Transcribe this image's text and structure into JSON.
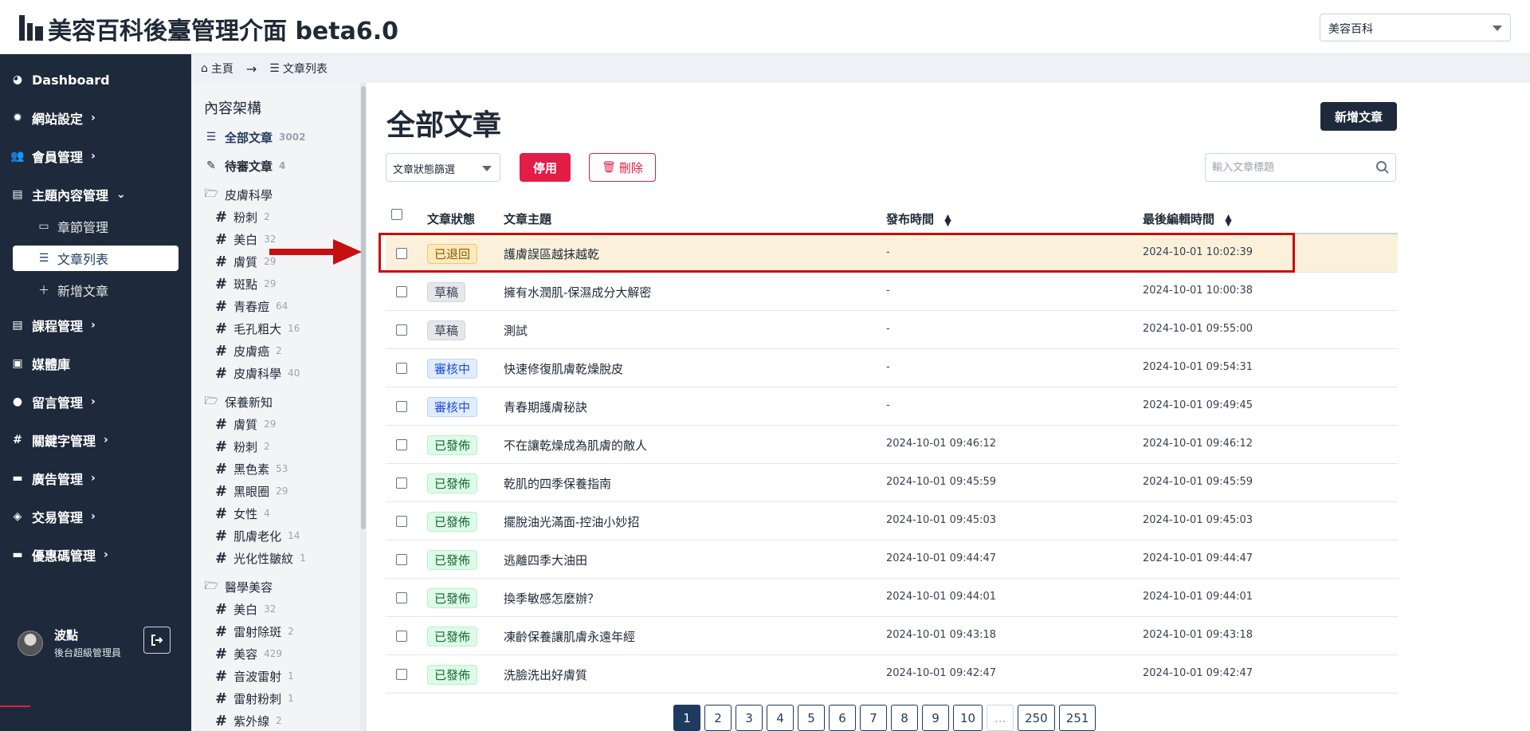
{
  "app": {
    "title": "美容百科後臺管理介面 beta6.0",
    "site_selector": "美容百科"
  },
  "sidebar": {
    "items": [
      {
        "label": "Dashboard",
        "icon": "dashboard-icon"
      },
      {
        "label": "網站設定",
        "icon": "gear-icon"
      },
      {
        "label": "會員管理",
        "icon": "users-icon"
      },
      {
        "label": "主題內容管理",
        "icon": "book-icon"
      },
      {
        "label": "課程管理",
        "icon": "book-icon"
      },
      {
        "label": "媒體庫",
        "icon": "images-icon"
      },
      {
        "label": "留言管理",
        "icon": "comment-icon"
      },
      {
        "label": "關鍵字管理",
        "icon": "hashtag-icon"
      },
      {
        "label": "廣告管理",
        "icon": "ad-icon"
      },
      {
        "label": "交易管理",
        "icon": "money-bag-icon"
      },
      {
        "label": "優惠碼管理",
        "icon": "ticket-icon"
      }
    ],
    "subitems": [
      {
        "label": "章節管理",
        "icon": "panel-icon"
      },
      {
        "label": "文章列表",
        "icon": "list-icon"
      },
      {
        "label": "新增文章",
        "icon": "plus-icon"
      }
    ],
    "user": {
      "name": "波點",
      "role": "後台超級管理員"
    }
  },
  "breadcrumb": {
    "home": "主頁",
    "current": "文章列表"
  },
  "tag_panel": {
    "title": "內容架構",
    "all": {
      "label": "全部文章",
      "count": "3002"
    },
    "pending": {
      "label": "待審文章",
      "count": "4"
    },
    "groups": [
      {
        "label": "皮膚科學",
        "tags": [
          {
            "label": "粉刺",
            "count": "2"
          },
          {
            "label": "美白",
            "count": "32"
          },
          {
            "label": "膚質",
            "count": "29"
          },
          {
            "label": "斑點",
            "count": "29"
          },
          {
            "label": "青春痘",
            "count": "64"
          },
          {
            "label": "毛孔粗大",
            "count": "16"
          },
          {
            "label": "皮膚癌",
            "count": "2"
          },
          {
            "label": "皮膚科學",
            "count": "40"
          }
        ]
      },
      {
        "label": "保養新知",
        "tags": [
          {
            "label": "膚質",
            "count": "29"
          },
          {
            "label": "粉刺",
            "count": "2"
          },
          {
            "label": "黑色素",
            "count": "53"
          },
          {
            "label": "黑眼圈",
            "count": "29"
          },
          {
            "label": "女性",
            "count": "4"
          },
          {
            "label": "肌膚老化",
            "count": "14"
          },
          {
            "label": "光化性皺紋",
            "count": "1"
          }
        ]
      },
      {
        "label": "醫學美容",
        "tags": [
          {
            "label": "美白",
            "count": "32"
          },
          {
            "label": "雷射除斑",
            "count": "2"
          },
          {
            "label": "美容",
            "count": "429"
          },
          {
            "label": "音波雷射",
            "count": "1"
          },
          {
            "label": "雷射粉刺",
            "count": "1"
          },
          {
            "label": "紫外線",
            "count": "2"
          }
        ]
      }
    ]
  },
  "main": {
    "title": "全部文章",
    "new_button": "新增文章",
    "filter": "文章狀態篩選",
    "disable_button": "停用",
    "delete_button": "刪除",
    "search_placeholder": "輸入文章標題",
    "columns": [
      "文章狀態",
      "文章主題",
      "發布時間",
      "最後編輯時間"
    ],
    "rows": [
      {
        "status": "已退回",
        "status_type": "returned",
        "title": "護膚誤區越抹越乾",
        "published": "-",
        "edited": "2024-10-01 10:02:39"
      },
      {
        "status": "草稿",
        "status_type": "draft",
        "title": "擁有水潤肌-保濕成分大解密",
        "published": "-",
        "edited": "2024-10-01 10:00:38"
      },
      {
        "status": "草稿",
        "status_type": "draft",
        "title": "測試",
        "published": "-",
        "edited": "2024-10-01 09:55:00"
      },
      {
        "status": "審核中",
        "status_type": "review",
        "title": "快速修復肌膚乾燥脫皮",
        "published": "-",
        "edited": "2024-10-01 09:54:31"
      },
      {
        "status": "審核中",
        "status_type": "review",
        "title": "青春期護膚秘訣",
        "published": "-",
        "edited": "2024-10-01 09:49:45"
      },
      {
        "status": "已發佈",
        "status_type": "published",
        "title": "不在讓乾燥成為肌膚的敵人",
        "published": "2024-10-01 09:46:12",
        "edited": "2024-10-01 09:46:12"
      },
      {
        "status": "已發佈",
        "status_type": "published",
        "title": "乾肌的四季保養指南",
        "published": "2024-10-01 09:45:59",
        "edited": "2024-10-01 09:45:59"
      },
      {
        "status": "已發佈",
        "status_type": "published",
        "title": "擺脫油光滿面-控油小妙招",
        "published": "2024-10-01 09:45:03",
        "edited": "2024-10-01 09:45:03"
      },
      {
        "status": "已發佈",
        "status_type": "published",
        "title": "逃離四季大油田",
        "published": "2024-10-01 09:44:47",
        "edited": "2024-10-01 09:44:47"
      },
      {
        "status": "已發佈",
        "status_type": "published",
        "title": "換季敏感怎麼辦？",
        "published": "2024-10-01 09:44:01",
        "edited": "2024-10-01 09:44:01"
      },
      {
        "status": "已發佈",
        "status_type": "published",
        "title": "凍齡保養讓肌膚永遠年經",
        "published": "2024-10-01 09:43:18",
        "edited": "2024-10-01 09:43:18"
      },
      {
        "status": "已發佈",
        "status_type": "published",
        "title": "洗臉洗出好膚質",
        "published": "2024-10-01 09:42:47",
        "edited": "2024-10-01 09:42:47"
      }
    ],
    "pagination": [
      "1",
      "2",
      "3",
      "4",
      "5",
      "6",
      "7",
      "8",
      "9",
      "10",
      "...",
      "250",
      "251"
    ],
    "current_page": "1"
  },
  "colors": {
    "sidebar_bg": "#1e2a3b",
    "primary": "#1e3a5f",
    "danger": "#e11d48",
    "highlight_row": "#fbf1db",
    "annotation_red": "#c60f0f"
  }
}
